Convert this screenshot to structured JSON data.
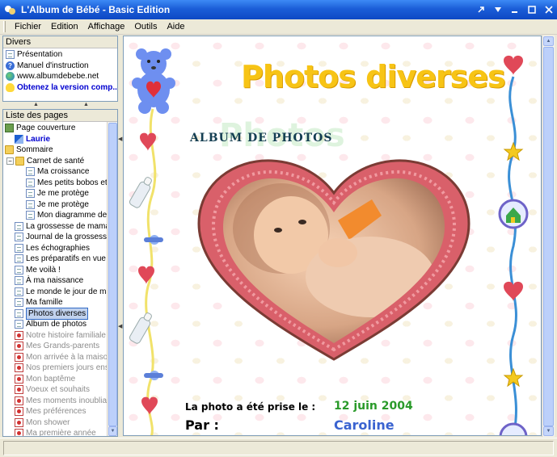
{
  "window": {
    "title": "L'Album de Bébé - Basic Edition"
  },
  "menu": {
    "items": [
      {
        "label": "Fichier"
      },
      {
        "label": "Edition"
      },
      {
        "label": "Affichage"
      },
      {
        "label": "Outils"
      },
      {
        "label": "Aide"
      }
    ]
  },
  "divers": {
    "header": "Divers",
    "items": [
      {
        "label": "Présentation",
        "icon": "page-icon"
      },
      {
        "label": "Manuel d'instruction",
        "icon": "help-icon"
      },
      {
        "label": "www.albumdebebe.net",
        "icon": "globe-icon"
      },
      {
        "label": "Obtenez la version comp...",
        "icon": "bulb-icon"
      }
    ]
  },
  "pages": {
    "header": "Liste des pages",
    "items": [
      {
        "label": "Page couverture",
        "icon": "cover-icon",
        "indent": 0,
        "style": "normal"
      },
      {
        "label": "Laurie",
        "icon": "pen-icon",
        "indent": 1,
        "style": "blue-bold"
      },
      {
        "label": "Sommaire",
        "icon": "folder-icon",
        "indent": 0,
        "style": "normal"
      },
      {
        "label": "Carnet de santé",
        "icon": "folder-icon",
        "indent": 1,
        "style": "normal",
        "expanded": true
      },
      {
        "label": "Ma croissance",
        "icon": "page-icon",
        "indent": 2,
        "style": "normal"
      },
      {
        "label": "Mes petits bobos et...",
        "icon": "page-icon",
        "indent": 2,
        "style": "normal"
      },
      {
        "label": "Je me protège",
        "icon": "page-icon",
        "indent": 2,
        "style": "normal"
      },
      {
        "label": "Je me protège",
        "icon": "page-icon",
        "indent": 2,
        "style": "normal"
      },
      {
        "label": "Mon diagramme de...",
        "icon": "page-icon",
        "indent": 2,
        "style": "normal"
      },
      {
        "label": "La grossesse de maman",
        "icon": "page-icon",
        "indent": 1,
        "style": "normal"
      },
      {
        "label": "Journal de la grossesse",
        "icon": "page-icon",
        "indent": 1,
        "style": "normal"
      },
      {
        "label": "Les échographies",
        "icon": "page-icon",
        "indent": 1,
        "style": "normal"
      },
      {
        "label": "Les préparatifs en vue ...",
        "icon": "page-icon",
        "indent": 1,
        "style": "normal"
      },
      {
        "label": "Me voilà !",
        "icon": "page-icon",
        "indent": 1,
        "style": "normal"
      },
      {
        "label": "À ma naissance",
        "icon": "page-icon",
        "indent": 1,
        "style": "normal"
      },
      {
        "label": "Le monde le jour de ma...",
        "icon": "page-icon",
        "indent": 1,
        "style": "normal"
      },
      {
        "label": "Ma famille",
        "icon": "page-icon",
        "indent": 1,
        "style": "normal"
      },
      {
        "label": "Photos diverses",
        "icon": "page-icon",
        "indent": 1,
        "style": "selected"
      },
      {
        "label": "Album de photos",
        "icon": "page-icon",
        "indent": 1,
        "style": "normal"
      },
      {
        "label": "Notre histoire familiale",
        "icon": "locked-icon",
        "indent": 1,
        "style": "grey"
      },
      {
        "label": "Mes Grands-parents",
        "icon": "locked-icon",
        "indent": 1,
        "style": "grey"
      },
      {
        "label": "Mon arrivée à la maison",
        "icon": "locked-icon",
        "indent": 1,
        "style": "grey"
      },
      {
        "label": "Nos premiers jours ens...",
        "icon": "locked-icon",
        "indent": 1,
        "style": "grey"
      },
      {
        "label": "Mon baptême",
        "icon": "locked-icon",
        "indent": 1,
        "style": "grey"
      },
      {
        "label": "Voeux et souhaits",
        "icon": "locked-icon",
        "indent": 1,
        "style": "grey"
      },
      {
        "label": "Mes moments inoubliab...",
        "icon": "locked-icon",
        "indent": 1,
        "style": "grey"
      },
      {
        "label": "Mes préférences",
        "icon": "locked-icon",
        "indent": 1,
        "style": "grey"
      },
      {
        "label": "Mon shower",
        "icon": "locked-icon",
        "indent": 1,
        "style": "grey"
      },
      {
        "label": "Ma première année",
        "icon": "locked-icon",
        "indent": 1,
        "style": "grey"
      }
    ]
  },
  "page": {
    "title": "Photos diverses",
    "album_label": "Album de photos",
    "ghost_text": "Photos",
    "photo_taken_label": "La photo a été prise le :",
    "photo_date": "12 juin 2004",
    "by_label": "Par :",
    "by_value": "Caroline"
  },
  "colors": {
    "title_yellow": "#f7c415",
    "date_green": "#2a9a2a",
    "name_blue": "#3a63d0",
    "heart_frame": "#d9606a"
  }
}
